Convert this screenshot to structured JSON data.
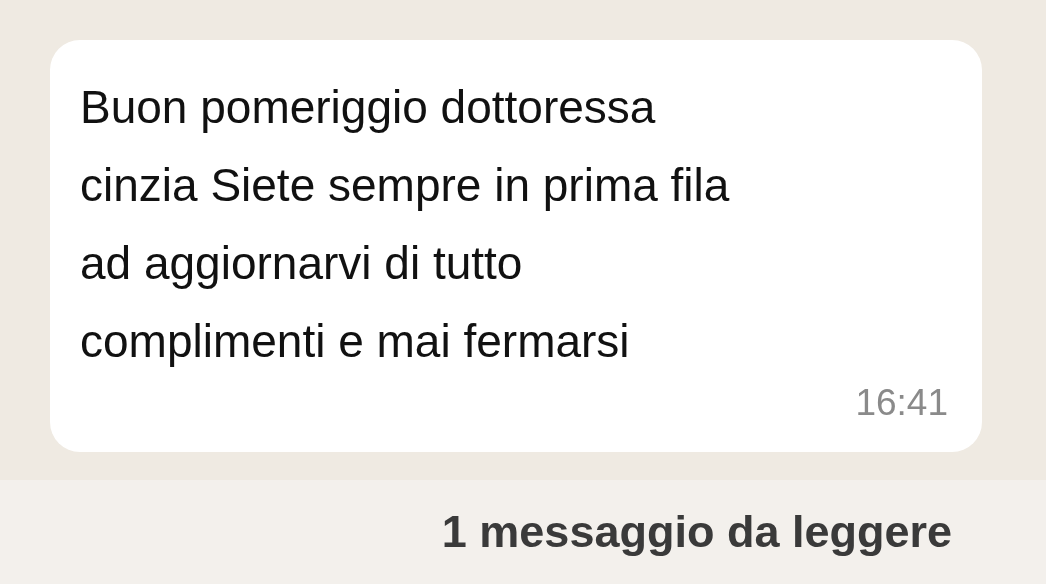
{
  "message": {
    "lines": [
      "Buon pomeriggio dottoressa",
      "cinzia Siete sempre in prima fila",
      "ad aggiornarvi di tutto",
      "complimenti e mai fermarsi"
    ],
    "time": "16:41"
  },
  "unread_banner": "1 messaggio da leggere"
}
